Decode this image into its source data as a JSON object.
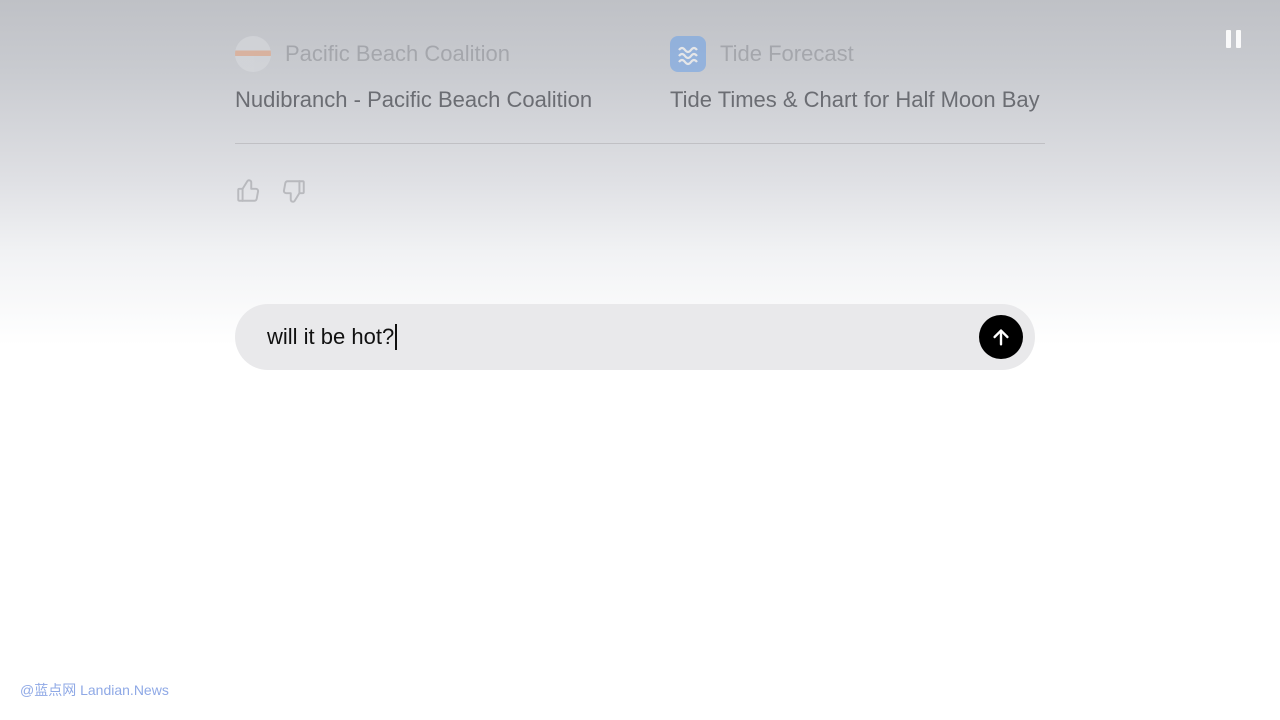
{
  "results": [
    {
      "source": "Pacific Beach Coalition",
      "title": "Nudibranch - Pacific Beach Coalition",
      "icon": "pacbeach"
    },
    {
      "source": "Tide Forecast",
      "title": "Tide Times & Chart for Half Moon Bay",
      "icon": "tide"
    }
  ],
  "input": {
    "value": "will it be hot?"
  },
  "watermark": "@蓝点网 Landian.News"
}
